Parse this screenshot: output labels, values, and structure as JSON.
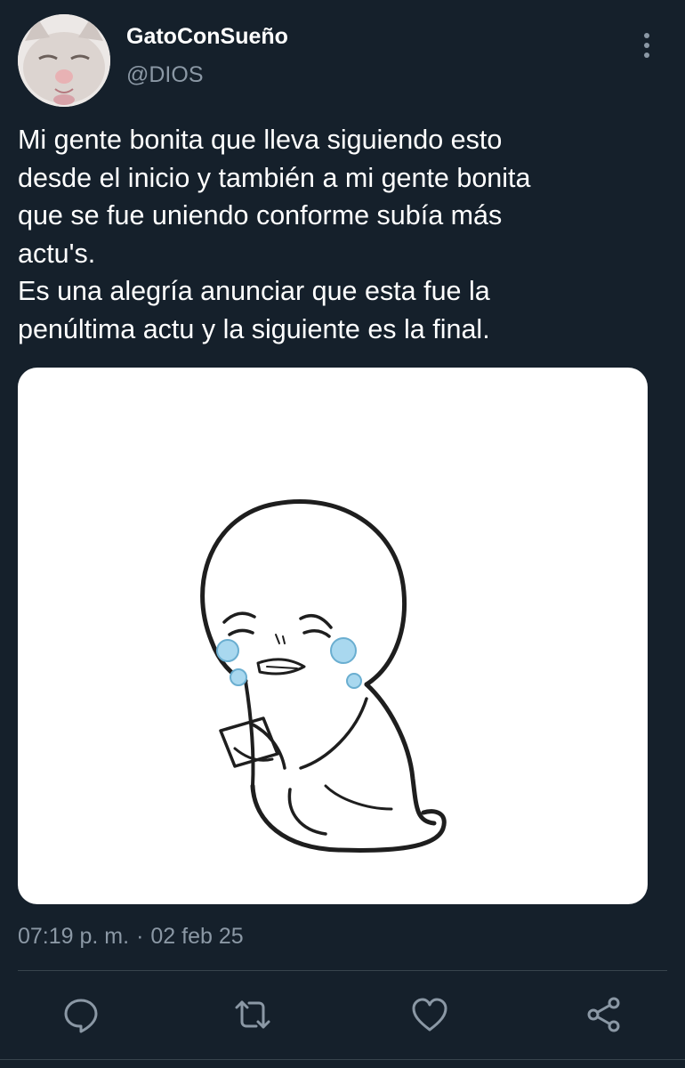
{
  "author": {
    "display_name": "GatoConSueño",
    "handle": "@DIOS",
    "avatar_icon": "sleepy-cat-avatar"
  },
  "tweet": {
    "text_lines": [
      "Mi gente bonita que lleva siguiendo esto",
      "desde el inicio y también a mi gente bonita",
      "que se fue uniendo conforme subía más",
      "actu's.",
      "Es una alegría anunciar que esta fue la",
      "penúltima actu y la siguiente es la final."
    ],
    "time": "07:19 p. m.",
    "separator": "·",
    "date": "02 feb 25"
  },
  "media": {
    "icon": "crying-character-illustration"
  },
  "actions": [
    {
      "icon": "reply-icon"
    },
    {
      "icon": "retweet-icon"
    },
    {
      "icon": "like-icon"
    },
    {
      "icon": "share-icon"
    }
  ],
  "colors": {
    "background": "#15202b",
    "primary_text": "#ffffff",
    "secondary_text": "#8b98a5",
    "divider": "#38444d",
    "tear": "#a9d8ef"
  }
}
